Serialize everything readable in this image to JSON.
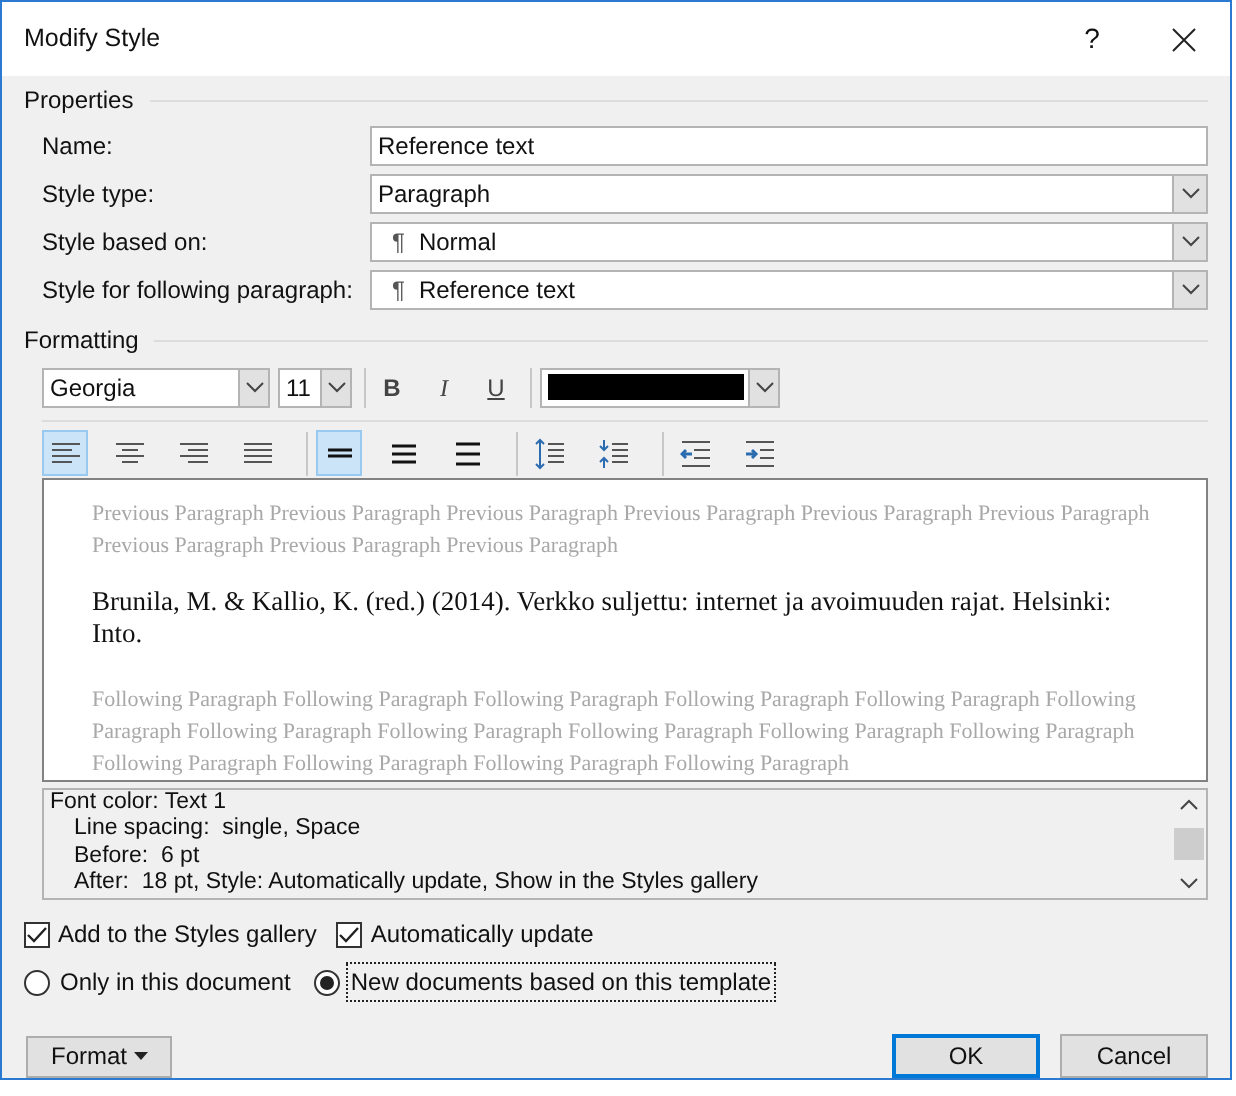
{
  "window": {
    "title": "Modify Style",
    "help": "?"
  },
  "properties": {
    "heading": "Properties",
    "fields": [
      {
        "kind": "text",
        "label": "Name:",
        "value": "Reference text"
      },
      {
        "kind": "select",
        "label": "Style type:",
        "value": "Paragraph"
      },
      {
        "kind": "select",
        "label": "Style based on:",
        "prefix": "¶",
        "value": "Normal"
      },
      {
        "kind": "select",
        "label": "Style for following paragraph:",
        "prefix": "¶",
        "value": "Reference text"
      }
    ]
  },
  "formatting": {
    "heading": "Formatting",
    "font": "Georgia",
    "size": "11",
    "bold": "B",
    "italic": "I",
    "underline": "U",
    "paragraph_buttons": [
      {
        "kind": "align-left",
        "selected": true
      },
      {
        "kind": "align-center",
        "selected": false
      },
      {
        "kind": "align-right",
        "selected": false
      },
      {
        "kind": "justify",
        "selected": false
      },
      {
        "kind": "single-spacing",
        "selected": true
      },
      {
        "kind": "one-half-spacing",
        "selected": false
      },
      {
        "kind": "double-spacing",
        "selected": false
      },
      {
        "kind": "increase-paragraph-spacing",
        "selected": false
      },
      {
        "kind": "decrease-paragraph-spacing",
        "selected": false
      },
      {
        "kind": "decrease-indent",
        "selected": false
      },
      {
        "kind": "increase-indent",
        "selected": false
      }
    ]
  },
  "preview": {
    "previous": "Previous Paragraph Previous Paragraph Previous Paragraph Previous Paragraph Previous Paragraph Previous Paragraph Previous Paragraph Previous Paragraph Previous Paragraph",
    "sample": "Brunila, M. & Kallio, K. (red.) (2014). Verkko suljettu: internet ja avoimuuden rajat. Helsinki: Into.",
    "following": "Following Paragraph Following Paragraph Following Paragraph Following Paragraph Following Paragraph Following Paragraph Following Paragraph Following Paragraph Following Paragraph Following Paragraph Following Paragraph Following Paragraph Following Paragraph Following Paragraph Following Paragraph"
  },
  "description": [
    "Font color: Text 1",
    "Line spacing:  single, Space",
    "Before:  6 pt",
    "After:  18 pt, Style: Automatically update, Show in the Styles gallery"
  ],
  "checkboxes": [
    {
      "label": "Add to the Styles gallery",
      "checked": true
    },
    {
      "label": "Automatically update",
      "checked": true
    }
  ],
  "radios": [
    {
      "label": "Only in this document",
      "selected": false
    },
    {
      "label": "New documents based on this template",
      "selected": true
    }
  ],
  "buttons": {
    "format": "Format",
    "ok": "OK",
    "cancel": "Cancel"
  }
}
